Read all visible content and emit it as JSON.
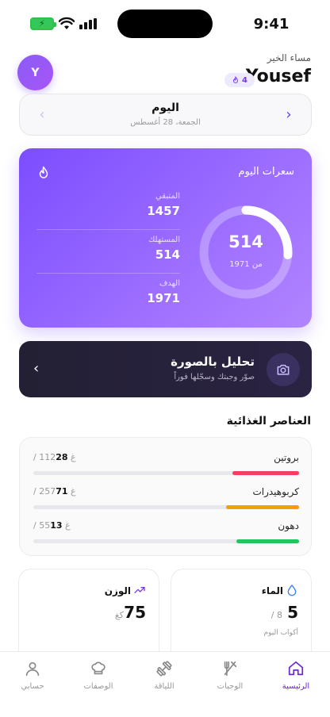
{
  "status": {
    "time": "9:41"
  },
  "header": {
    "greeting": "مساء الخير",
    "user_name": "Yousef",
    "avatar_initial": "Y",
    "streak_count": "4"
  },
  "date_card": {
    "title": "اليوم",
    "subtitle": "الجمعة، 28 أغسطس"
  },
  "calories": {
    "title": "سعرات اليوم",
    "value": "514",
    "of_label": "من 1971",
    "consumed_fraction": 0.26,
    "stats": [
      {
        "label": "المتبقي",
        "value": "1457"
      },
      {
        "label": "المستهلك",
        "value": "514"
      },
      {
        "label": "الهدف",
        "value": "1971"
      }
    ]
  },
  "photo_analysis": {
    "title": "تحليل بالصورة",
    "subtitle": "صوّر وجبتك وسجّلها فوراً"
  },
  "nutrients": {
    "title": "العناصر الغذائية",
    "items": [
      {
        "name": "بروتين",
        "consumed": "28",
        "target": "/ 112غ",
        "fraction": 0.25,
        "color": "#f43f5e"
      },
      {
        "name": "كربوهيدرات",
        "consumed": "71",
        "target": "/ 257غ",
        "fraction": 0.276,
        "color": "#f59e0b"
      },
      {
        "name": "دهون",
        "consumed": "13",
        "target": "/ 55غ",
        "fraction": 0.236,
        "color": "#22c55e"
      }
    ]
  },
  "water": {
    "title": "الماء",
    "value": "5",
    "target": "/ 8",
    "caption": "أكواب اليوم"
  },
  "weight": {
    "title": "الوزن",
    "value": "75",
    "unit": "كغ"
  },
  "tabs": [
    {
      "label": "الرئيسية",
      "icon": "home-icon",
      "active": true
    },
    {
      "label": "الوجبات",
      "icon": "utensils-icon",
      "active": false
    },
    {
      "label": "اللياقة",
      "icon": "dumbbell-icon",
      "active": false
    },
    {
      "label": "الوصفات",
      "icon": "chef-hat-icon",
      "active": false
    },
    {
      "label": "حسابي",
      "icon": "user-icon",
      "active": false
    }
  ],
  "colors": {
    "accent": "#7c4dff",
    "dark_card": "#232034",
    "active_tab": "#6d28d9"
  }
}
